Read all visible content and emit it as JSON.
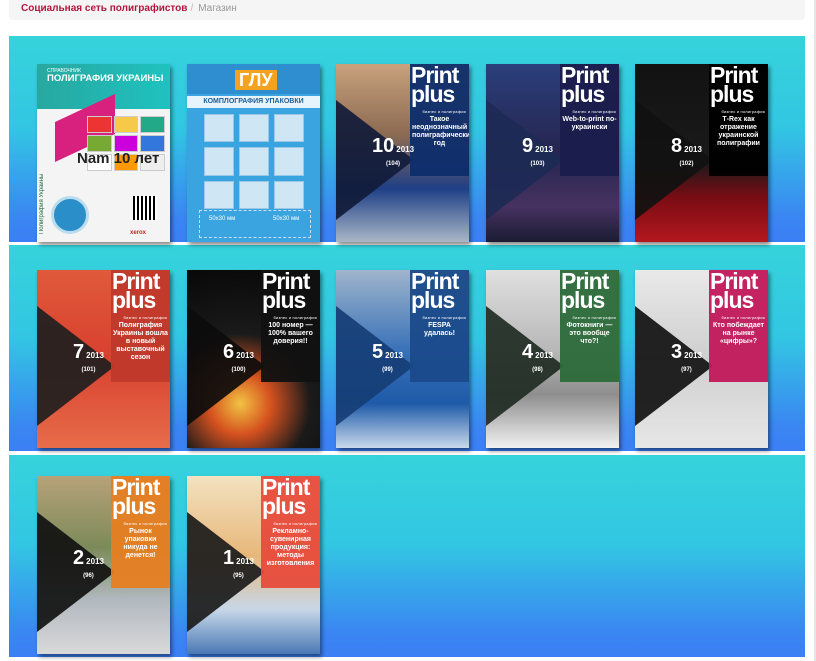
{
  "breadcrumb": {
    "home_label": "Социальная сеть полиграфистов",
    "separator": "/",
    "current_label": "Магазин"
  },
  "brand": {
    "title_letters": "Print\nplus",
    "subtitle": "бизнес и полиграфия"
  },
  "covers": [
    {
      "label": "Полиграфия Украины",
      "heading": "ПОЛИГРАФИЯ УКРАИНЫ",
      "top_note": "СПРАВОЧНИК",
      "mid": "Nam 10 лет",
      "brand_mark": "xerox"
    },
    {
      "label": "Комплография упаковки",
      "heading": "КОМПЛОГРАФИЯ УПАКОВКИ",
      "mark": "ГЛУ",
      "box_left": "50x30 мм",
      "box_right": "50x30 мм"
    },
    {
      "label": "Print plus 10/2013",
      "issue": "10",
      "year": "2013",
      "issue_no": "(104)",
      "headline": "Такое неоднозначный полиграфический год"
    },
    {
      "label": "Print plus 9/2013",
      "issue": "9",
      "year": "2013",
      "issue_no": "(103)",
      "headline": "Web-to-print по-украински"
    },
    {
      "label": "Print plus 8/2013",
      "issue": "8",
      "year": "2013",
      "issue_no": "(102)",
      "headline": "Т-Rex как отражение украинской полиграфии"
    },
    {
      "label": "Print plus 7/2013",
      "issue": "7",
      "year": "2013",
      "issue_no": "(101)",
      "headline": "Полиграфия Украины вошла в новый выставочный сезон"
    },
    {
      "label": "Print plus 6/2013",
      "issue": "6",
      "year": "2013",
      "issue_no": "(100)",
      "headline": "100 номер — 100% вашего доверия!!"
    },
    {
      "label": "Print plus 5/2013",
      "issue": "5",
      "year": "2013",
      "issue_no": "(99)",
      "headline": "FESPA удалась!"
    },
    {
      "label": "Print plus 4/2013",
      "issue": "4",
      "year": "2013",
      "issue_no": "(98)",
      "headline": "Фотокниги — это вообще что?!"
    },
    {
      "label": "Print plus 3/2013",
      "issue": "3",
      "year": "2013",
      "issue_no": "(97)",
      "headline": "Кто побеждает на рынке «цифры»?"
    },
    {
      "label": "Print plus 2/2013",
      "issue": "2",
      "year": "2013",
      "issue_no": "(96)",
      "headline": "Рынок упаковки никуда не денется!"
    },
    {
      "label": "Print plus 1/2013",
      "issue": "1",
      "year": "2013",
      "issue_no": "(95)",
      "headline": "Рекламно-сувенирная продукция: методы изготовления"
    }
  ],
  "colors": {
    "shelf_top": "#36d3db",
    "shelf_bottom": "#3b7ff5",
    "breadcrumb_link": "#b0163e"
  }
}
